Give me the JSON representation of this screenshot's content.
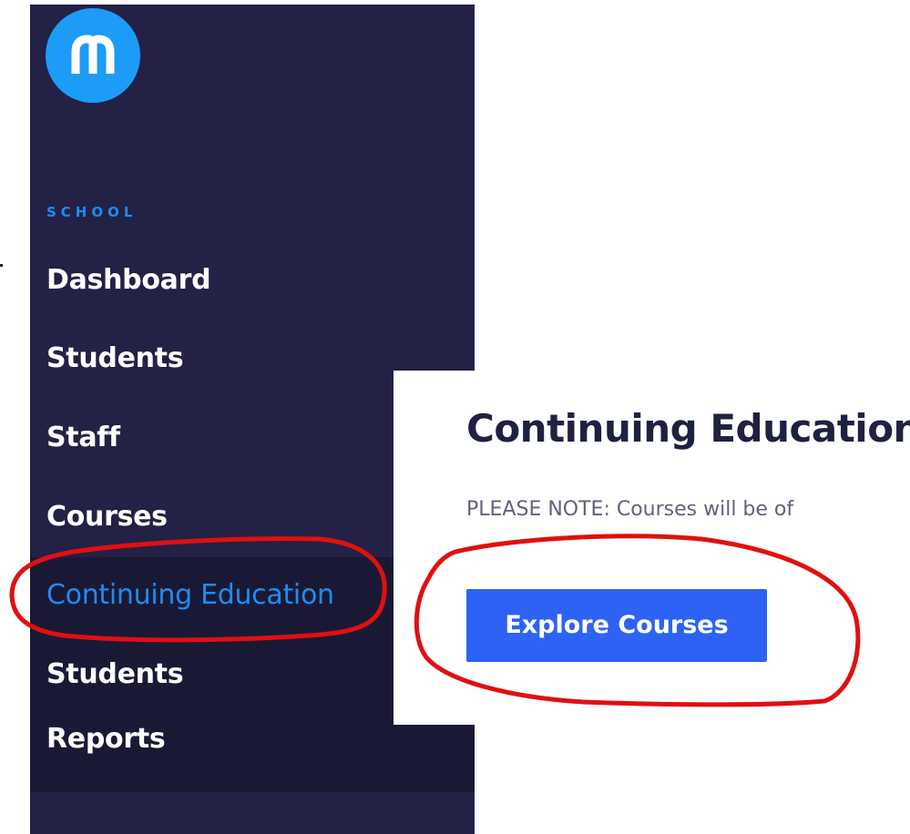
{
  "sidebar": {
    "logo_icon": "m-logo-icon",
    "section_label": "SCHOOL",
    "items": [
      {
        "label": "Dashboard"
      },
      {
        "label": "Students"
      },
      {
        "label": "Staff"
      },
      {
        "label": "Courses"
      },
      {
        "label": "Continuing Education",
        "active": true
      },
      {
        "label": "Students"
      },
      {
        "label": "Reports"
      }
    ]
  },
  "main": {
    "title": "Continuing Education",
    "note": "PLEASE NOTE: Courses will be of",
    "explore_button": "Explore Courses"
  },
  "colors": {
    "sidebar_bg": "#232145",
    "sidebar_sub_bg": "#1a1935",
    "accent": "#1e8cf4",
    "button": "#2c63f5",
    "annotation": "#e01010"
  }
}
